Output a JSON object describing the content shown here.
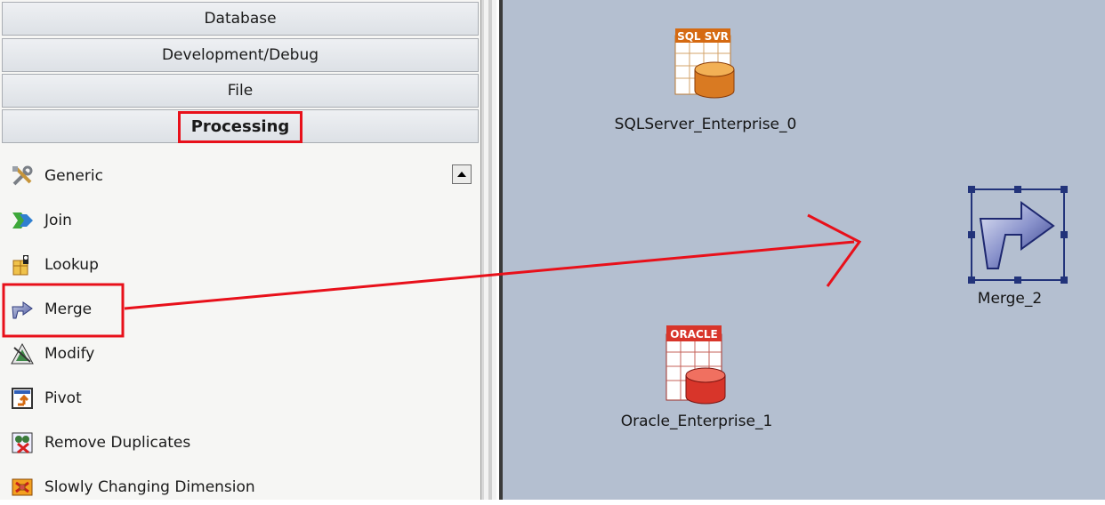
{
  "palette": {
    "categories": [
      {
        "label": "Database"
      },
      {
        "label": "Development/Debug"
      },
      {
        "label": "File"
      },
      {
        "label": "Processing"
      }
    ],
    "items": [
      {
        "label": "Generic",
        "icon": "tools-icon"
      },
      {
        "label": "Join",
        "icon": "join-arrows-icon"
      },
      {
        "label": "Lookup",
        "icon": "lookup-icon"
      },
      {
        "label": "Merge",
        "icon": "merge-arrow-icon"
      },
      {
        "label": "Modify",
        "icon": "modify-icon"
      },
      {
        "label": "Pivot",
        "icon": "pivot-icon"
      },
      {
        "label": "Remove Duplicates",
        "icon": "remove-duplicates-icon"
      },
      {
        "label": "Slowly Changing Dimension",
        "icon": "slowly-changing-dimension-icon"
      }
    ]
  },
  "canvas": {
    "stages": [
      {
        "name": "SQLServer_Enterprise_0",
        "badge": "SQL SVR"
      },
      {
        "name": "Oracle_Enterprise_1",
        "badge": "ORACLE"
      },
      {
        "name": "Merge_2"
      }
    ]
  },
  "colors": {
    "annotation": "#e8101a",
    "canvas": "#b4bfd0",
    "selection": "#22337a"
  }
}
